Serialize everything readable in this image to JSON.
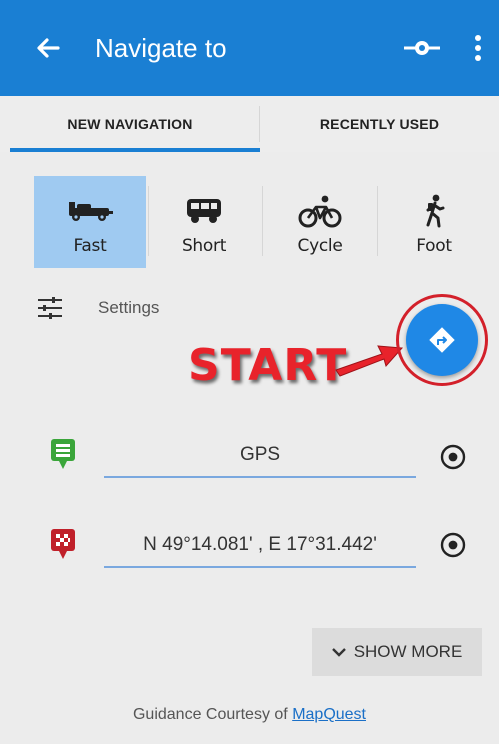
{
  "appbar": {
    "title": "Navigate to",
    "back_icon": "arrow-left-icon",
    "route_icon": "route-icon",
    "more_icon": "more-vert-icon",
    "color": "#1a7fd3"
  },
  "tabs": [
    {
      "label": "NEW NAVIGATION",
      "selected": true
    },
    {
      "label": "RECENTLY USED",
      "selected": false
    }
  ],
  "modes": [
    {
      "label": "Fast",
      "icon": "race-car-icon",
      "selected": true
    },
    {
      "label": "Short",
      "icon": "van-icon",
      "selected": false
    },
    {
      "label": "Cycle",
      "icon": "bicycle-icon",
      "selected": false
    },
    {
      "label": "Foot",
      "icon": "hiker-icon",
      "selected": false
    }
  ],
  "settings": {
    "label": "Settings",
    "icon": "sliders-icon"
  },
  "start": {
    "label": "START",
    "icon": "turn-right-icon",
    "annotation_color": "#e8232b"
  },
  "route_points": [
    {
      "value": "GPS",
      "icon": "start-flag-icon",
      "color": "#3aa53a"
    },
    {
      "value": "N 49°14.081' , E 17°31.442'",
      "icon": "finish-flag-icon",
      "color": "#c0202a"
    }
  ],
  "show_more": {
    "label": "SHOW MORE",
    "icon": "chevron-down-icon"
  },
  "footer": {
    "text": "Guidance Courtesy of",
    "link": "MapQuest"
  }
}
